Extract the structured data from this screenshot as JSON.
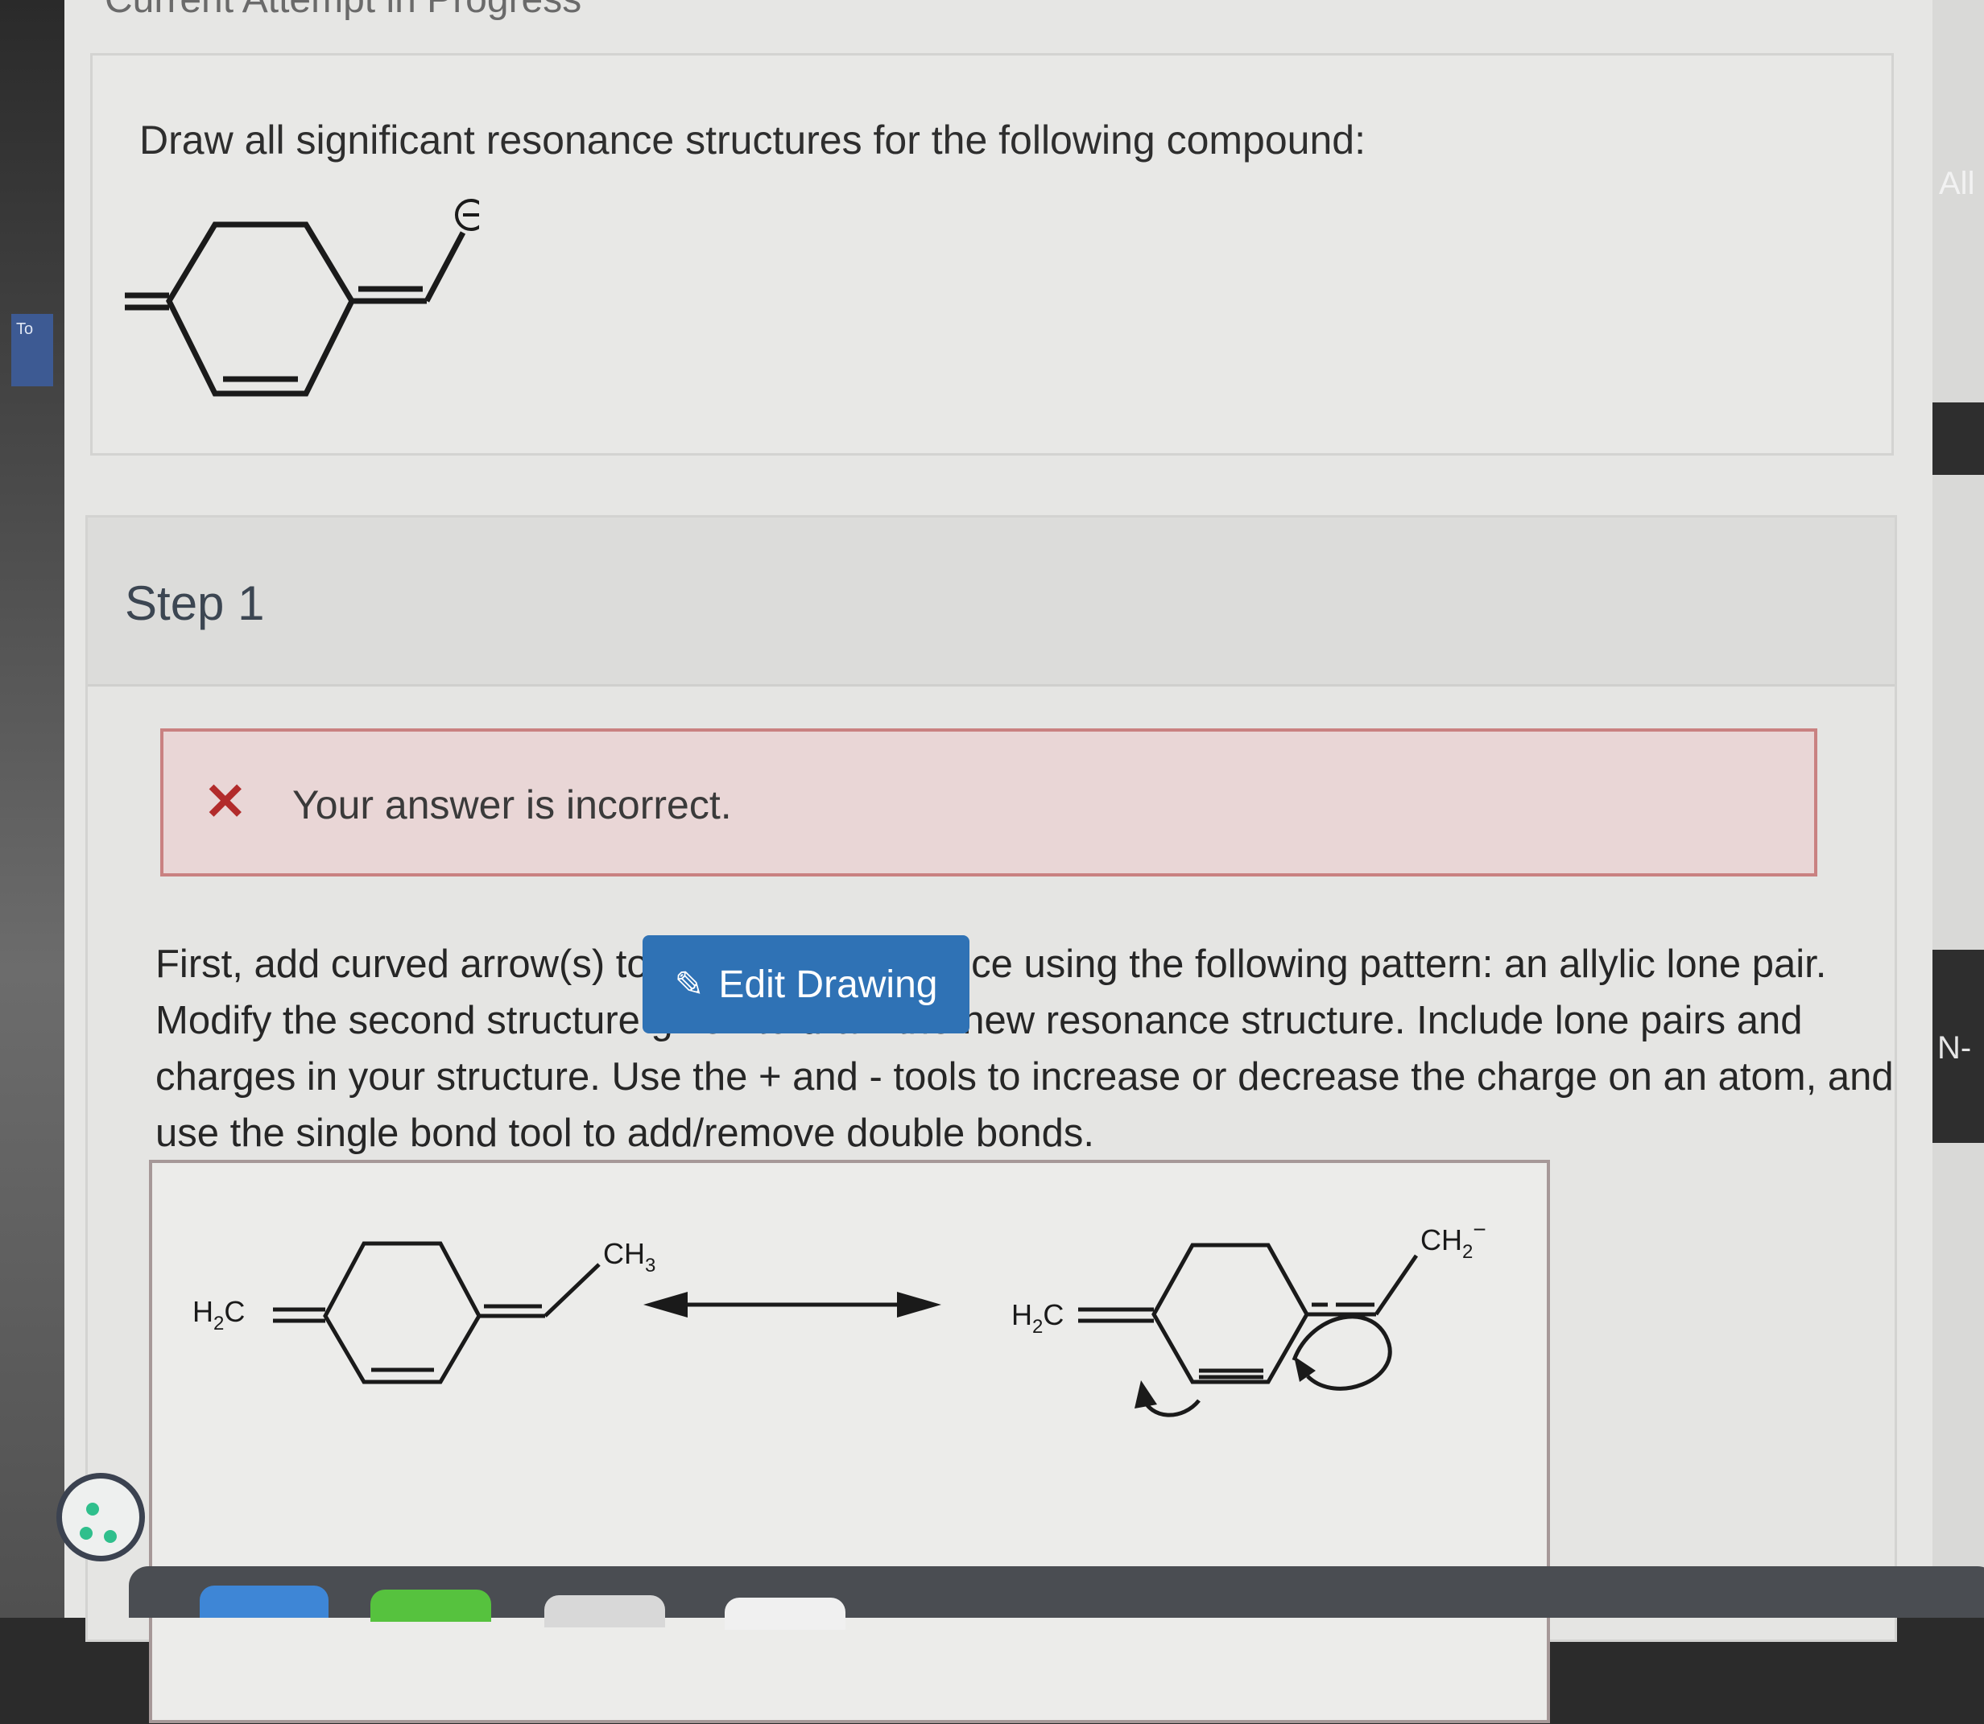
{
  "header": {
    "title": "Current Attempt in Progress"
  },
  "question": {
    "prompt": "Draw all significant resonance structures for the following compound:",
    "charge_symbol": "⊖"
  },
  "step": {
    "title": "Step 1",
    "feedback": {
      "icon": "close-icon",
      "message": "Your answer is incorrect."
    },
    "instructions": "First, add curved arrow(s) to show the resonance using the following pattern: an allylic lone pair. Modify the second structure given to draw the new resonance structure. Include lone pairs and charges in your structure. Use the + and - tools to increase or decrease the charge on an atom, and use the single bond tool to add/remove double bonds.",
    "drawing": {
      "left_label_main": "H",
      "left_label_sub": "2",
      "left_label_tail": "C",
      "ch3_main": "CH",
      "ch3_sub": "3",
      "right_label_main": "H",
      "right_label_sub": "2",
      "right_label_tail": "C",
      "ch2_main": "CH",
      "ch2_sub": "2",
      "ch2_sup": "−"
    },
    "edit_button": "Edit Drawing"
  },
  "sidebar": {
    "left_tab": "To",
    "right_text_1": "All",
    "right_text_2": "N-"
  },
  "colors": {
    "feedback_bg": "#e9d6d6",
    "feedback_border": "#c98181",
    "button": "#2f72b5",
    "error": "#b22b2b"
  }
}
